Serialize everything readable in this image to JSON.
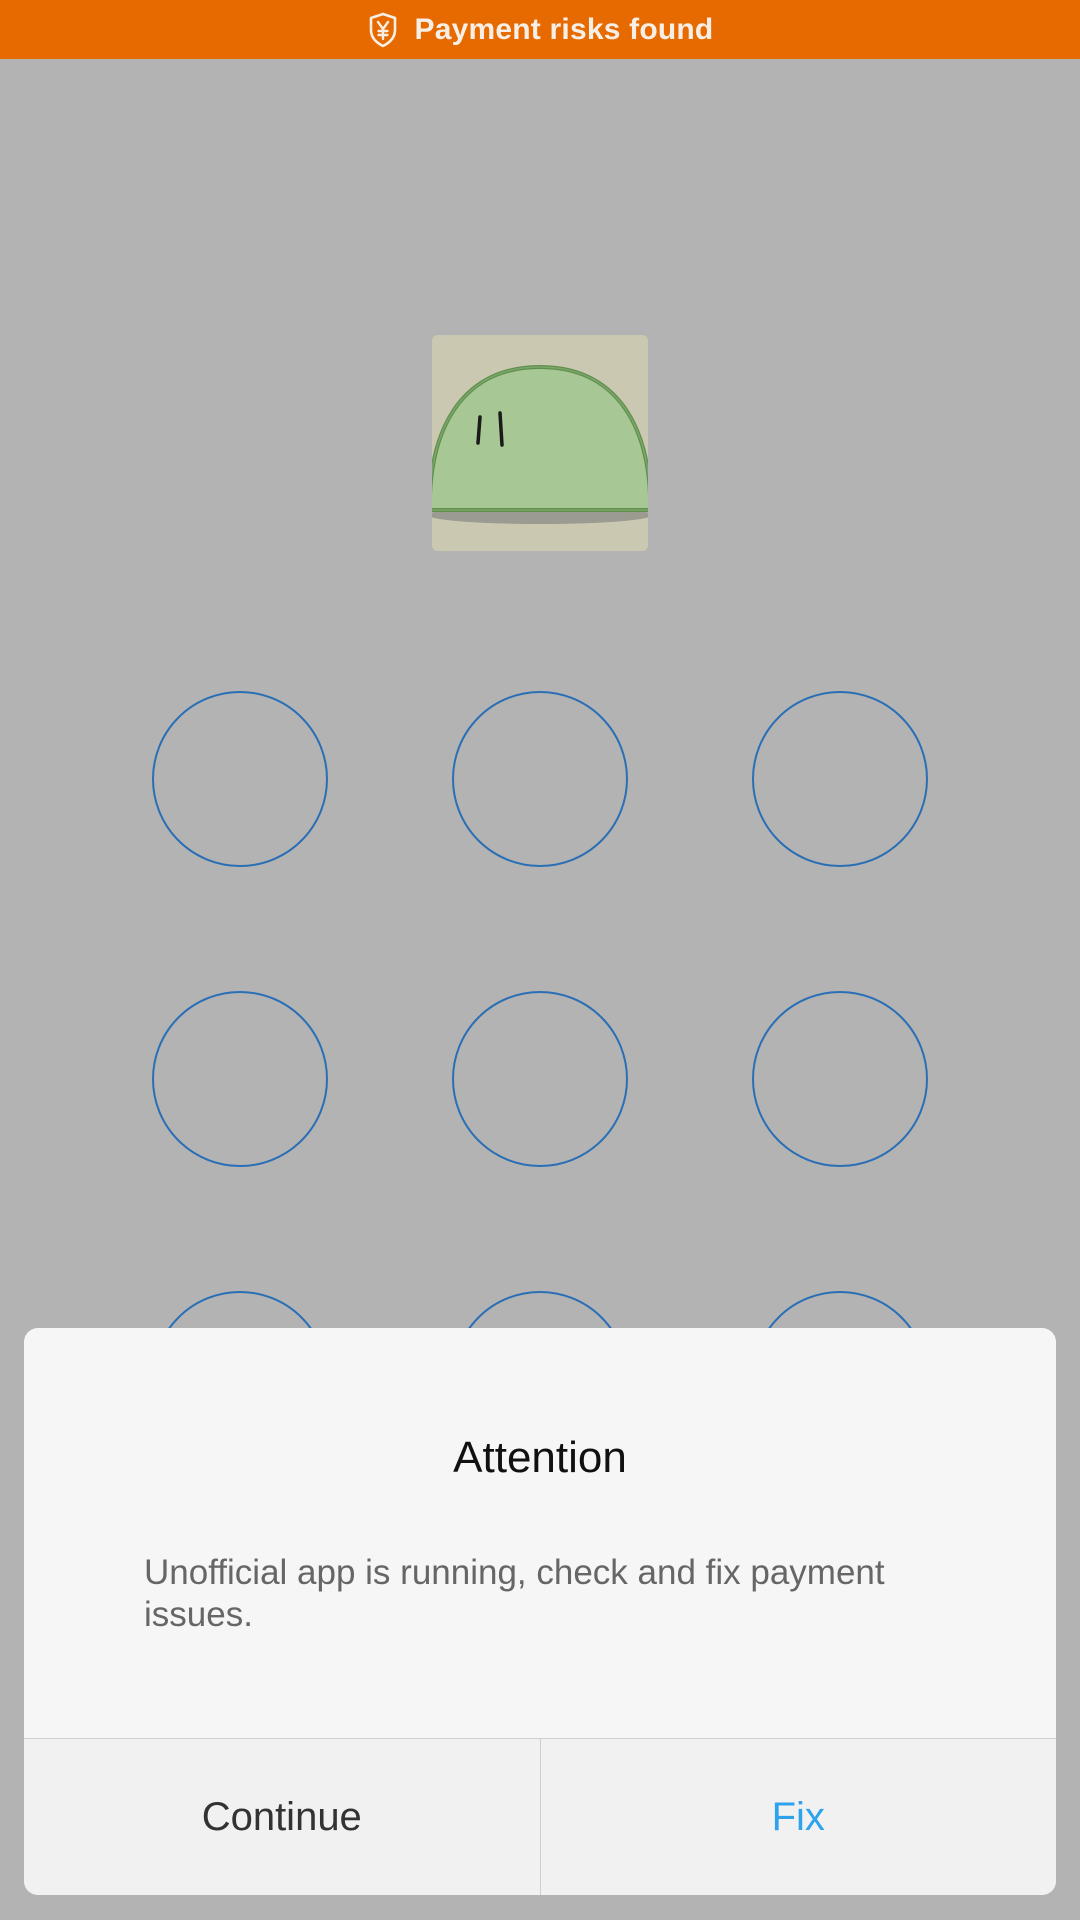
{
  "banner": {
    "text": "Payment risks found",
    "icon": "shield-yen-icon",
    "color": "#e66a00"
  },
  "avatar": {
    "icon": "green-blob-avatar"
  },
  "pattern_lock": {
    "dot_color": "#2a6fb5",
    "rows": 3,
    "cols": 3
  },
  "dialog": {
    "title": "Attention",
    "message": "Unofficial app is running, check and fix payment issues.",
    "continue_label": "Continue",
    "fix_label": "Fix",
    "fix_color": "#2fa2ee"
  }
}
